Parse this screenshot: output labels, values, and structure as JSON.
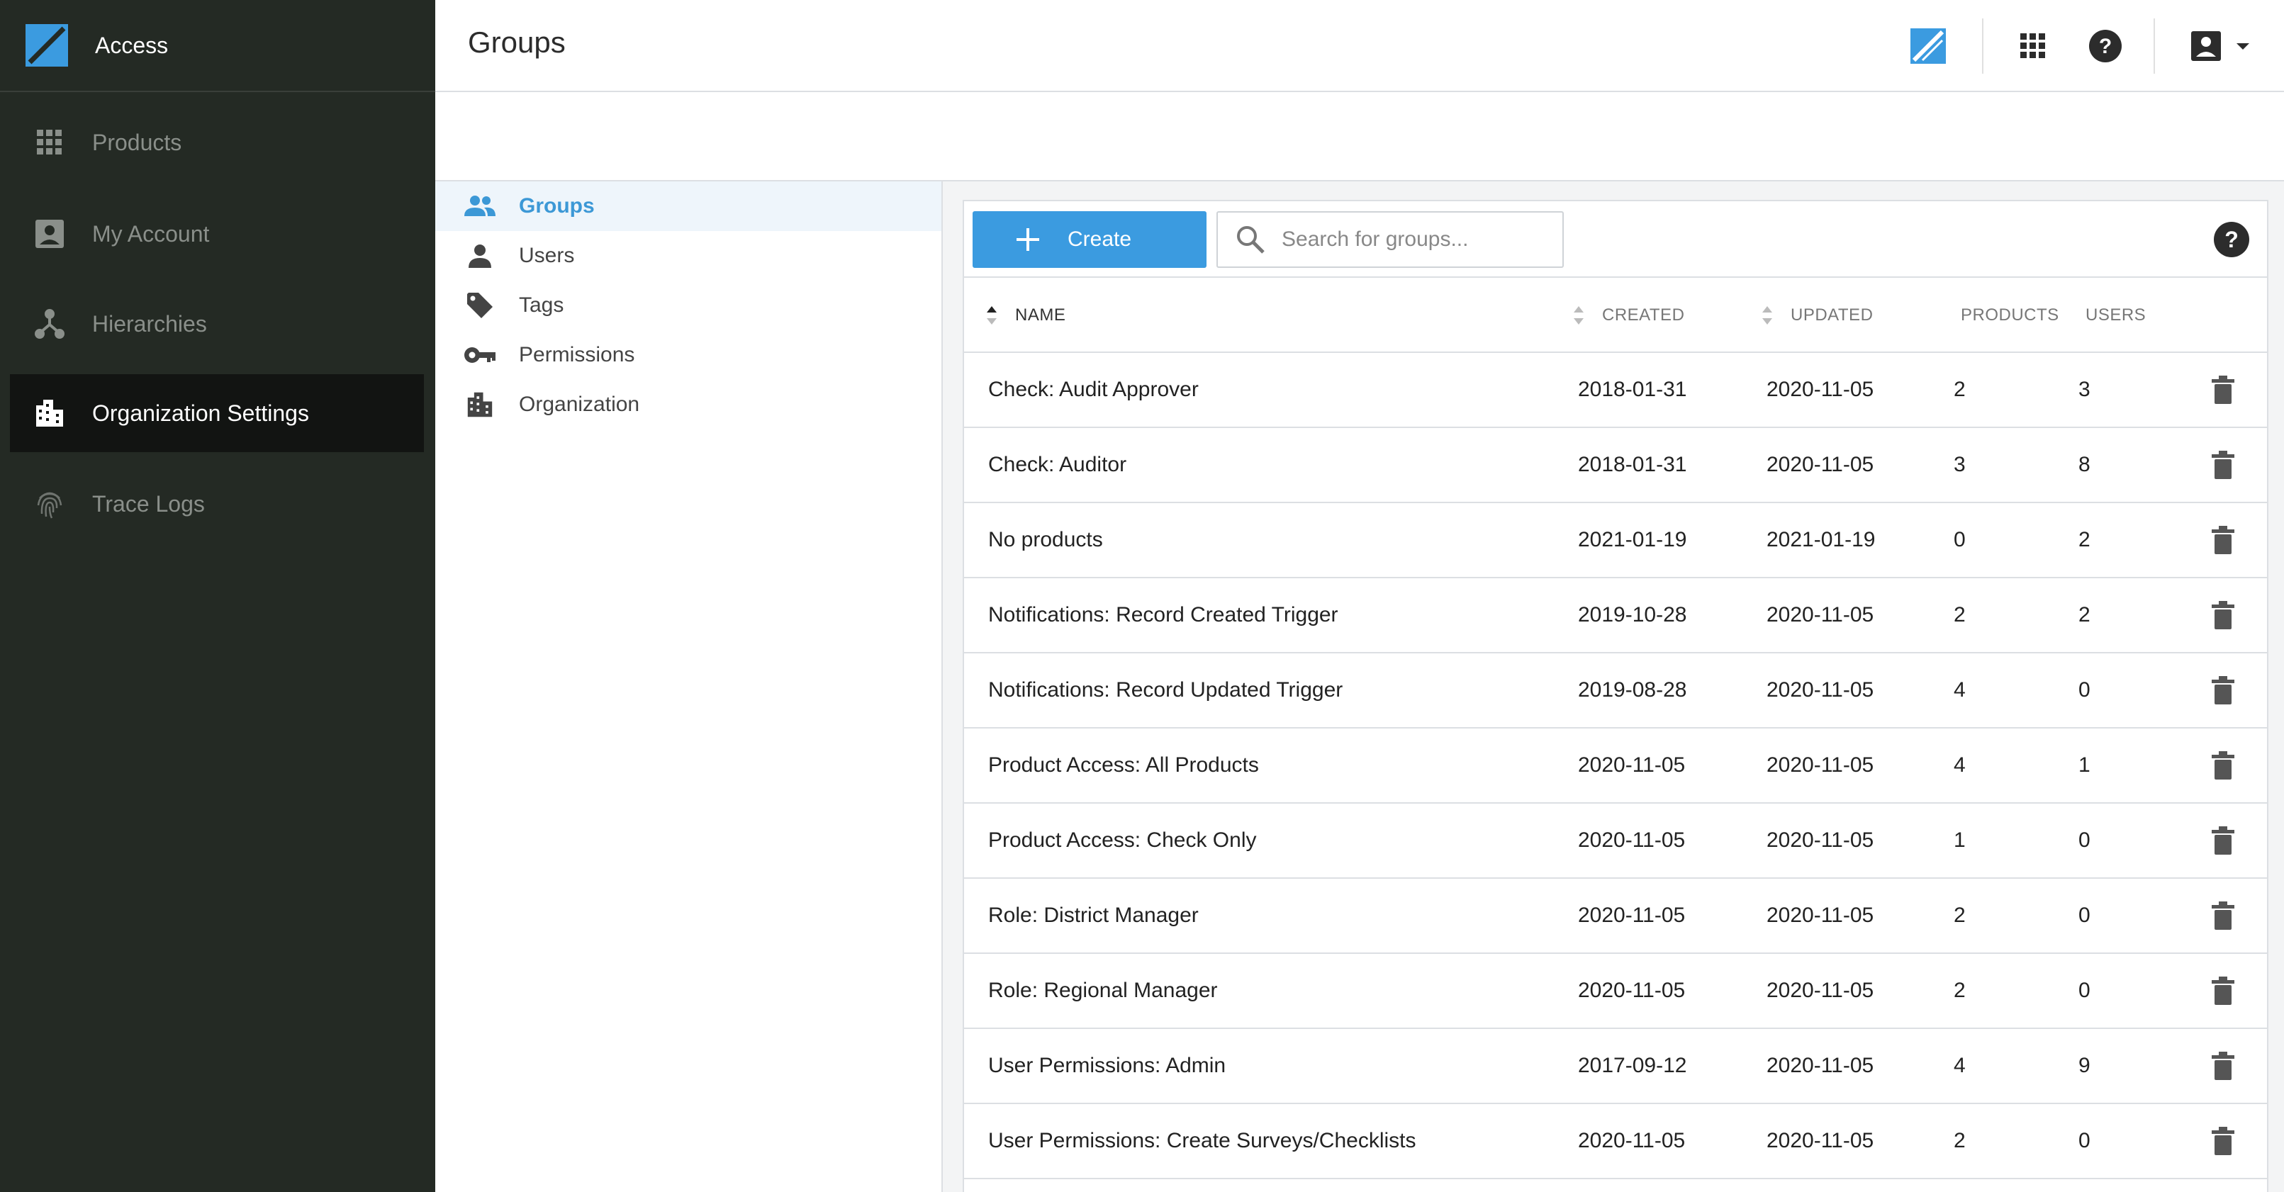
{
  "app": {
    "name": "Access",
    "logo_icon": "access-logo-icon"
  },
  "sidebar": {
    "items": [
      {
        "label": "Products",
        "icon": "grid-icon",
        "active": false
      },
      {
        "label": "My Account",
        "icon": "account-box-icon",
        "active": false
      },
      {
        "label": "Hierarchies",
        "icon": "hierarchy-icon",
        "active": false
      },
      {
        "label": "Organization Settings",
        "icon": "building-icon",
        "active": true
      },
      {
        "label": "Trace Logs",
        "icon": "fingerprint-icon",
        "active": false
      }
    ]
  },
  "header": {
    "title": "Groups",
    "icons": [
      "access-logo-icon",
      "apps-grid-icon",
      "help-icon",
      "account-icon",
      "chevron-down-icon"
    ]
  },
  "subnav": {
    "items": [
      {
        "label": "Groups",
        "icon": "people-icon",
        "active": true
      },
      {
        "label": "Users",
        "icon": "person-icon",
        "active": false
      },
      {
        "label": "Tags",
        "icon": "tag-icon",
        "active": false
      },
      {
        "label": "Permissions",
        "icon": "key-icon",
        "active": false
      },
      {
        "label": "Organization",
        "icon": "building-icon",
        "active": false
      }
    ]
  },
  "toolbar": {
    "create_label": "Create",
    "search_placeholder": "Search for groups...",
    "search_value": ""
  },
  "table": {
    "columns": {
      "name": "NAME",
      "created": "CREATED",
      "updated": "UPDATED",
      "products": "PRODUCTS",
      "users": "USERS"
    },
    "rows": [
      {
        "name": "Check: Audit Approver",
        "created": "2018-01-31",
        "updated": "2020-11-05",
        "products": "2",
        "users": "3"
      },
      {
        "name": "Check: Auditor",
        "created": "2018-01-31",
        "updated": "2020-11-05",
        "products": "3",
        "users": "8"
      },
      {
        "name": "No products",
        "created": "2021-01-19",
        "updated": "2021-01-19",
        "products": "0",
        "users": "2"
      },
      {
        "name": "Notifications: Record Created Trigger",
        "created": "2019-10-28",
        "updated": "2020-11-05",
        "products": "2",
        "users": "2"
      },
      {
        "name": "Notifications: Record Updated Trigger",
        "created": "2019-08-28",
        "updated": "2020-11-05",
        "products": "4",
        "users": "0"
      },
      {
        "name": "Product Access: All Products",
        "created": "2020-11-05",
        "updated": "2020-11-05",
        "products": "4",
        "users": "1"
      },
      {
        "name": "Product Access: Check Only",
        "created": "2020-11-05",
        "updated": "2020-11-05",
        "products": "1",
        "users": "0"
      },
      {
        "name": "Role: District Manager",
        "created": "2020-11-05",
        "updated": "2020-11-05",
        "products": "2",
        "users": "0"
      },
      {
        "name": "Role: Regional Manager",
        "created": "2020-11-05",
        "updated": "2020-11-05",
        "products": "2",
        "users": "0"
      },
      {
        "name": "User Permissions: Admin",
        "created": "2017-09-12",
        "updated": "2020-11-05",
        "products": "4",
        "users": "9"
      },
      {
        "name": "User Permissions: Create Surveys/Checklists",
        "created": "2020-11-05",
        "updated": "2020-11-05",
        "products": "2",
        "users": "0"
      }
    ]
  },
  "colors": {
    "sidebar_bg": "#242a24",
    "sidebar_active_bg": "#121412",
    "accent": "#3b9be0",
    "subnav_active_bg": "#eef5fb"
  }
}
